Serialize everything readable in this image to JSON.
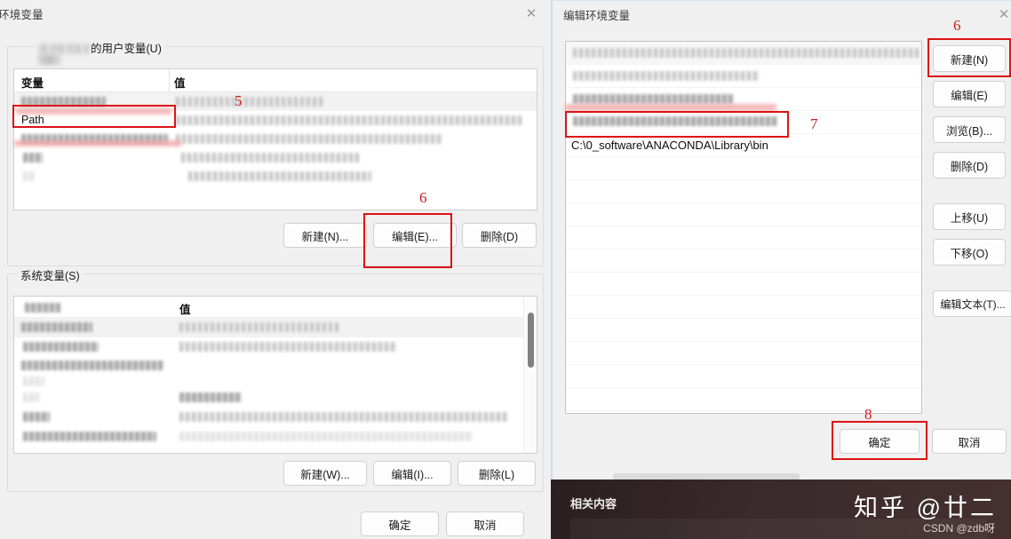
{
  "env_dialog": {
    "title": "环境变量",
    "close_icon": "close-icon",
    "user_group": {
      "legend_suffix": "的用户变量(U)",
      "columns": [
        "变量",
        "值"
      ],
      "selected_variable": "Path",
      "buttons": [
        {
          "label": "新建(N)..."
        },
        {
          "label": "编辑(E)..."
        },
        {
          "label": "删除(D)"
        }
      ]
    },
    "system_group": {
      "legend": "系统变量(S)",
      "columns": [
        "变量",
        "值"
      ],
      "buttons": [
        {
          "label": "新建(W)..."
        },
        {
          "label": "编辑(I)..."
        },
        {
          "label": "删除(L)"
        }
      ]
    },
    "footer_buttons": [
      {
        "label": "确定"
      },
      {
        "label": "取消"
      }
    ]
  },
  "edit_dialog": {
    "title": "编辑环境变量",
    "close_icon": "close-icon",
    "highlighted_path": "C:\\0_software\\ANACONDA\\Library\\bin",
    "side_buttons": [
      {
        "label": "新建(N)"
      },
      {
        "label": "编辑(E)"
      },
      {
        "label": "浏览(B)..."
      },
      {
        "label": "删除(D)"
      },
      {
        "label": "上移(U)"
      },
      {
        "label": "下移(O)"
      },
      {
        "label": "编辑文本(T)..."
      }
    ],
    "footer_buttons": [
      {
        "label": "确定"
      },
      {
        "label": "取消"
      }
    ]
  },
  "annotations": {
    "n5": "5",
    "n6_left": "6",
    "n6_right": "6",
    "n7": "7",
    "n8": "8",
    "accent_color": "#dc1414"
  },
  "overlay": {
    "related_label": "相关内容",
    "watermark_zhihu": "知乎 @廿二",
    "watermark_csdn": "CSDN @zdb呀"
  }
}
